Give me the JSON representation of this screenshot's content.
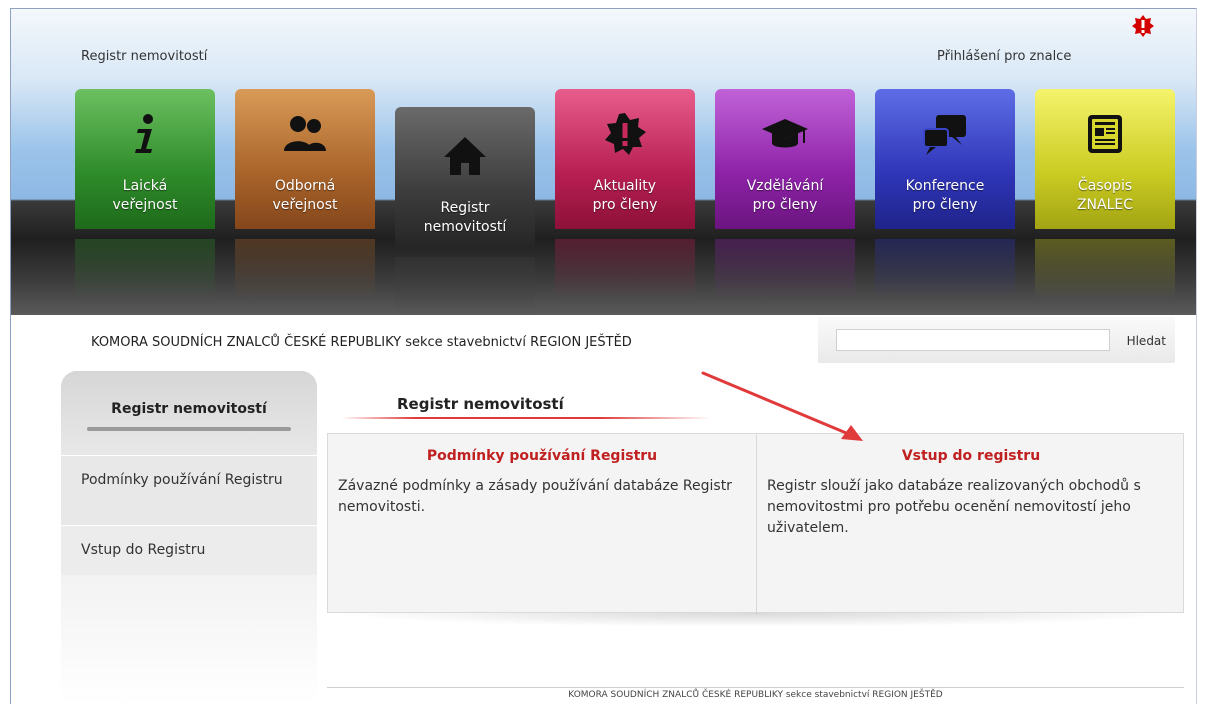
{
  "header": {
    "brand_link": "Registr nemovitostí",
    "login_link": "Přihlášení pro znalce"
  },
  "tiles": [
    {
      "line1": "Laická",
      "line2": "veřejnost",
      "icon": "info-icon"
    },
    {
      "line1": "Odborná",
      "line2": "veřejnost",
      "icon": "people-icon"
    },
    {
      "line1": "Registr",
      "line2": "nemovitostí",
      "icon": "home-icon"
    },
    {
      "line1": "Aktuality",
      "line2": "pro členy",
      "icon": "alert-badge-icon"
    },
    {
      "line1": "Vzdělávání",
      "line2": "pro členy",
      "icon": "graduation-cap-icon"
    },
    {
      "line1": "Konference",
      "line2": "pro členy",
      "icon": "chat-bubbles-icon"
    },
    {
      "line1": "Časopis",
      "line2": "ZNALEC",
      "icon": "newspaper-icon"
    }
  ],
  "org_line": "KOMORA SOUDNÍCH ZNALCŮ ČESKÉ REPUBLIKY sekce stavebnictví REGION JEŠTĚD",
  "search": {
    "placeholder": "",
    "button_label": "Hledat"
  },
  "sidebar": {
    "title": "Registr nemovitostí",
    "items": [
      {
        "label": "Podmínky používání Registru"
      },
      {
        "label": "Vstup do Registru"
      }
    ]
  },
  "main": {
    "title": "Registr nemovitostí",
    "panels": [
      {
        "title": "Podmínky používání Registru",
        "text": "Závazné podmínky a zásady používání databáze Registr nemovitosti."
      },
      {
        "title": "Vstup do registru",
        "text": "Registr slouží jako databáze realizovaných obchodů s nemovitostmi pro potřebu ocenění nemovitostí jeho uživatelem."
      }
    ]
  },
  "footer": "KOMORA SOUDNÍCH ZNALCŮ ČESKÉ REPUBLIKY sekce stavebnictví REGION JEŠTĚD",
  "colors": {
    "accent_red": "#c02020",
    "annotation_arrow": "#e03a3a"
  }
}
